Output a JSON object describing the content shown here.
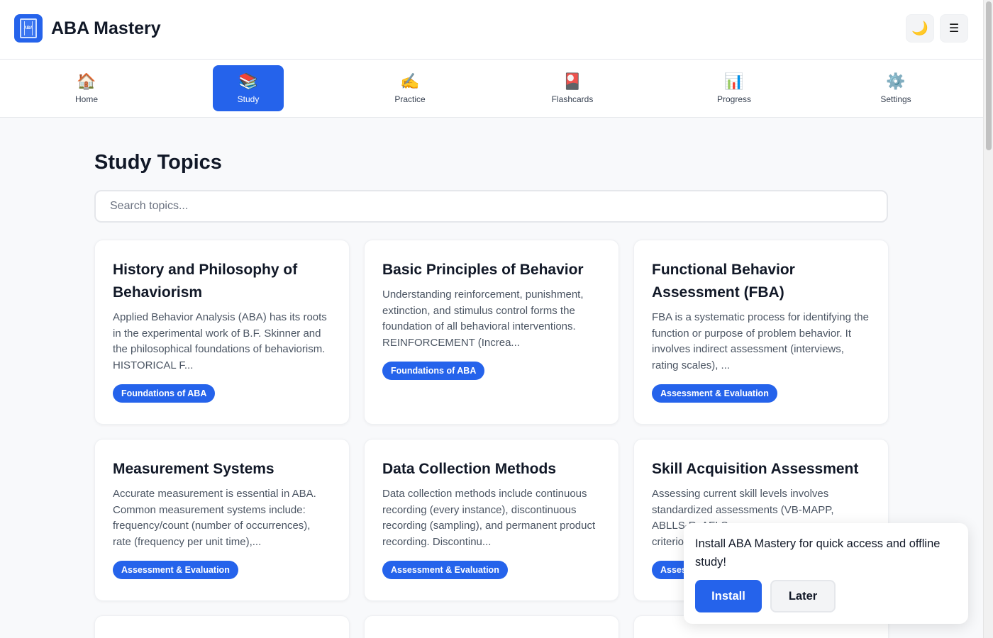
{
  "header": {
    "logo_text": "ABA",
    "title": "ABA Mastery",
    "theme_icon": "🌙",
    "menu_icon": "☰"
  },
  "nav": {
    "items": [
      {
        "label": "Home",
        "icon": "🏠"
      },
      {
        "label": "Study",
        "icon": "📚"
      },
      {
        "label": "Practice",
        "icon": "✍️"
      },
      {
        "label": "Flashcards",
        "icon": "🎴"
      },
      {
        "label": "Progress",
        "icon": "📊"
      },
      {
        "label": "Settings",
        "icon": "⚙️"
      }
    ],
    "active": "Study"
  },
  "main": {
    "title": "Study Topics",
    "search_placeholder": "Search topics...",
    "topics": [
      {
        "title": "History and Philosophy of Behaviorism",
        "excerpt": "Applied Behavior Analysis (ABA) has its roots in the experimental work of B.F. Skinner and the philosophical foundations of behaviorism. HISTORICAL F...",
        "category": "Foundations of ABA"
      },
      {
        "title": "Basic Principles of Behavior",
        "excerpt": "Understanding reinforcement, punishment, extinction, and stimulus control forms the foundation of all behavioral interventions. REINFORCEMENT (Increa...",
        "category": "Foundations of ABA"
      },
      {
        "title": "Functional Behavior Assessment (FBA)",
        "excerpt": "FBA is a systematic process for identifying the function or purpose of problem behavior. It involves indirect assessment (interviews, rating scales), ...",
        "category": "Assessment & Evaluation"
      },
      {
        "title": "Measurement Systems",
        "excerpt": "Accurate measurement is essential in ABA. Common measurement systems include: frequency/count (number of occurrences), rate (frequency per unit time),...",
        "category": "Assessment & Evaluation"
      },
      {
        "title": "Data Collection Methods",
        "excerpt": "Data collection methods include continuous recording (every instance), discontinuous recording (sampling), and permanent product recording. Discontinu...",
        "category": "Assessment & Evaluation"
      },
      {
        "title": "Skill Acquisition Assessment",
        "excerpt": "Assessing current skill levels involves standardized assessments (VB-MAPP, ABLLS-R, AFLS",
        "excerpt_tail": "criterio",
        "category": "Assessment & Evaluation"
      }
    ]
  },
  "install_prompt": {
    "message": "Install ABA Mastery for quick access and offline study!",
    "install_label": "Install",
    "later_label": "Later"
  },
  "colors": {
    "accent": "#2563eb",
    "background": "#f8f9fb",
    "text": "#111827"
  }
}
